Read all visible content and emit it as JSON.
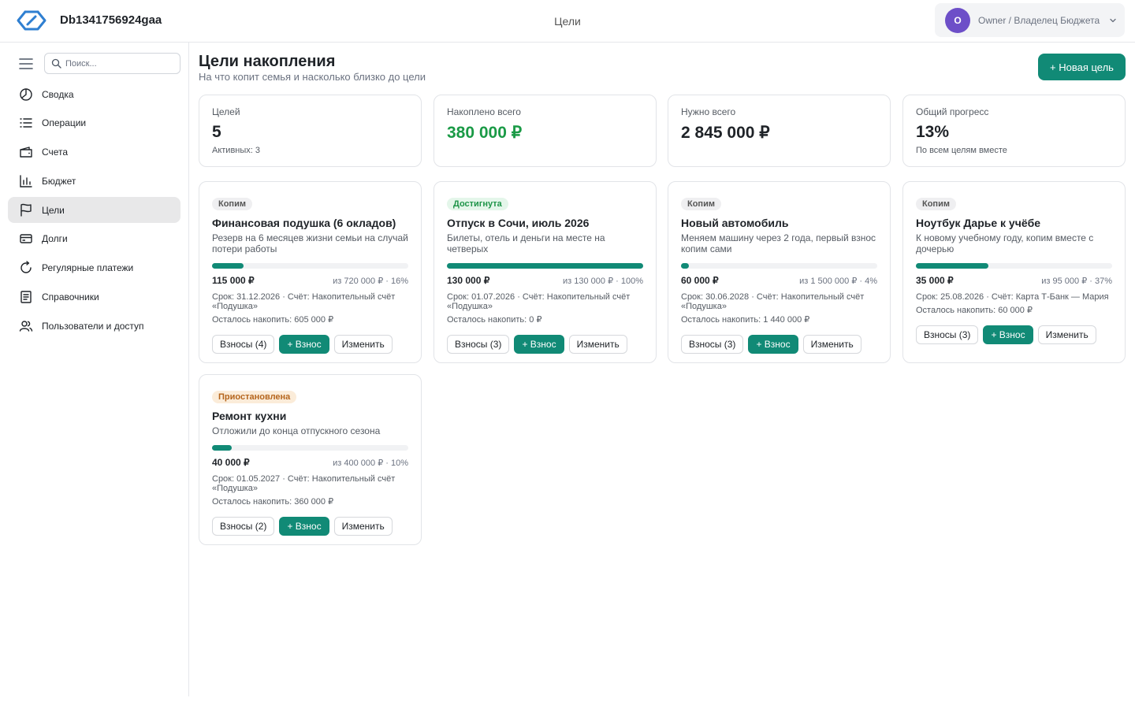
{
  "app": {
    "title": "Db1341756924gaa",
    "section": "Цели"
  },
  "user": {
    "initial": "O",
    "name": "Owner / Владелец Бюджета"
  },
  "search": {
    "placeholder": "Поиск..."
  },
  "nav": [
    {
      "label": "Сводка",
      "icon": "pie-chart-icon"
    },
    {
      "label": "Операции",
      "icon": "list-icon"
    },
    {
      "label": "Счета",
      "icon": "wallet-icon"
    },
    {
      "label": "Бюджет",
      "icon": "bar-chart-icon"
    },
    {
      "label": "Цели",
      "icon": "flag-icon",
      "active": true
    },
    {
      "label": "Долги",
      "icon": "credit-card-icon"
    },
    {
      "label": "Регулярные платежи",
      "icon": "refresh-icon"
    },
    {
      "label": "Справочники",
      "icon": "book-icon"
    },
    {
      "label": "Пользователи и доступ",
      "icon": "users-icon"
    }
  ],
  "page": {
    "title": "Цели накопления",
    "subtitle": "На что копит семья и насколько близко до цели",
    "new_button": "+ Новая цель"
  },
  "stats": [
    {
      "label": "Целей",
      "value": "5",
      "note": "Активных: 3"
    },
    {
      "label": "Накоплено всего",
      "value": "380 000 ₽",
      "note": ""
    },
    {
      "label": "Нужно всего",
      "value": "2 845 000 ₽",
      "note": ""
    },
    {
      "label": "Общий прогресс",
      "value": "13%",
      "note": "По всем целям вместе"
    }
  ],
  "goals": [
    {
      "status": "Копим",
      "title": "Финансовая подушка (6 окладов)",
      "description": "Резерв на 6 месяцев жизни семьи на случай потери работы",
      "progress": 16,
      "saved": "115 000 ₽",
      "of": "из 720 000 ₽ · 16%",
      "meta": "Срок: 31.12.2026 · Счёт: Накопительный счёт «Подушка»",
      "remaining": "Осталось накопить: 605 000 ₽",
      "contributions": "Взносы (4)",
      "add": "+ Взнос",
      "edit": "Изменить"
    },
    {
      "status": "Достигнута",
      "title": "Отпуск в Сочи, июль 2026",
      "description": "Билеты, отель и деньги на месте на четверых",
      "progress": 100,
      "saved": "130 000 ₽",
      "of": "из 130 000 ₽ · 100%",
      "meta": "Срок: 01.07.2026 · Счёт: Накопительный счёт «Подушка»",
      "remaining": "Осталось накопить: 0 ₽",
      "contributions": "Взносы (3)",
      "add": "+ Взнос",
      "edit": "Изменить"
    },
    {
      "status": "Копим",
      "title": "Новый автомобиль",
      "description": "Меняем машину через 2 года, первый взнос копим сами",
      "progress": 4,
      "saved": "60 000 ₽",
      "of": "из 1 500 000 ₽ · 4%",
      "meta": "Срок: 30.06.2028 · Счёт: Накопительный счёт «Подушка»",
      "remaining": "Осталось накопить: 1 440 000 ₽",
      "contributions": "Взносы (3)",
      "add": "+ Взнос",
      "edit": "Изменить"
    },
    {
      "status": "Копим",
      "title": "Ноутбук Дарье к учёбе",
      "description": "К новому учебному году, копим вместе с дочерью",
      "progress": 37,
      "saved": "35 000 ₽",
      "of": "из 95 000 ₽ · 37%",
      "meta": "Срок: 25.08.2026 · Счёт: Карта Т-Банк — Мария",
      "remaining": "Осталось накопить: 60 000 ₽",
      "contributions": "Взносы (3)",
      "add": "+ Взнос",
      "edit": "Изменить"
    },
    {
      "status": "Приостановлена",
      "title": "Ремонт кухни",
      "description": "Отложили до конца отпускного сезона",
      "progress": 10,
      "saved": "40 000 ₽",
      "of": "из 400 000 ₽ · 10%",
      "meta": "Срок: 01.05.2027 · Счёт: Накопительный счёт «Подушка»",
      "remaining": "Осталось накопить: 360 000 ₽",
      "contributions": "Взносы (2)",
      "add": "+ Взнос",
      "edit": "Изменить"
    }
  ],
  "colors": {
    "accent": "#118a76",
    "positive": "#1a9a46",
    "avatar": "#6d4fc8"
  }
}
